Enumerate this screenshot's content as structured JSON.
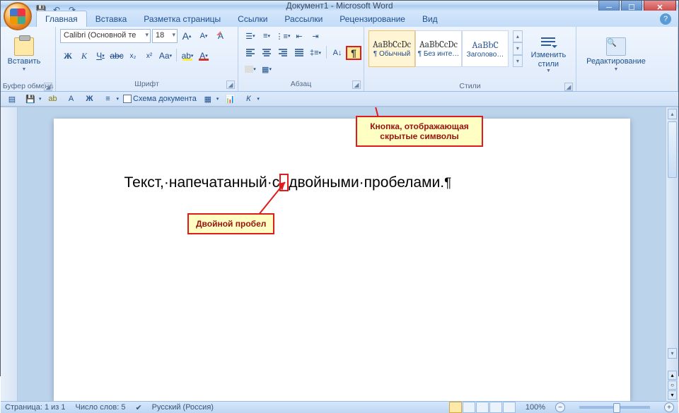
{
  "window": {
    "title": "Документ1 - Microsoft Word"
  },
  "tabs": {
    "home": "Главная",
    "insert": "Вставка",
    "layout": "Разметка страницы",
    "refs": "Ссылки",
    "mail": "Рассылки",
    "review": "Рецензирование",
    "view": "Вид"
  },
  "groups": {
    "clipboard": "Буфер обмена",
    "font": "Шрифт",
    "paragraph": "Абзац",
    "styles": "Стили",
    "editing": "Редактирование"
  },
  "clipboard": {
    "paste": "Вставить"
  },
  "font": {
    "name": "Calibri (Основной те",
    "size": "18",
    "grow": "A",
    "shrink": "A",
    "clear": "Aa"
  },
  "styles": {
    "preview": "AaBbCcDc",
    "preview_h": "AaBbC",
    "normal": "¶ Обычный",
    "no_spacing": "¶ Без инте…",
    "heading1": "Заголово…",
    "change": "Изменить стили"
  },
  "editing": {
    "label": "Редактирование"
  },
  "toolbar2": {
    "doc_map": "Схема документа"
  },
  "document": {
    "line": "Текст,·напечатанный·с··двойными·пробелами.¶",
    "part1": "Текст,·напечатанный·с",
    "dot": "·",
    "part2": "двойными·пробелами.",
    "pil": "¶"
  },
  "callouts": {
    "pilcrow": "Кнопка, отображающая скрытые символы",
    "double_space": "Двойной пробел"
  },
  "status": {
    "page": "Страница: 1 из 1",
    "words": "Число слов: 5",
    "lang": "Русский (Россия)",
    "zoom": "100%"
  }
}
